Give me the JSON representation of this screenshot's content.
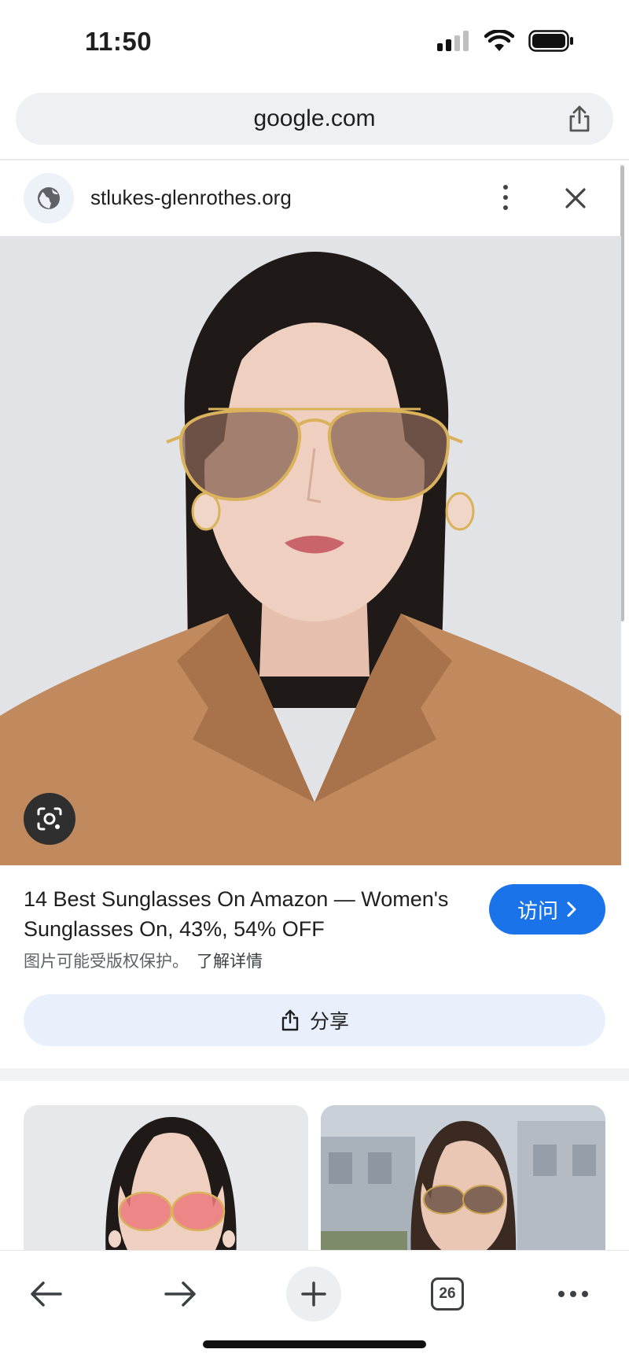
{
  "status_bar": {
    "time": "11:50",
    "icons": [
      "cellular-signal-icon",
      "wifi-icon",
      "battery-icon"
    ]
  },
  "address_bar": {
    "url": "google.com",
    "share_icon": "share-icon"
  },
  "site_header": {
    "site_name": "stlukes-glenrothes.org",
    "icons": [
      "globe-icon",
      "more-vert-icon",
      "close-icon"
    ]
  },
  "main_image": {
    "lens_icon": "google-lens-icon"
  },
  "result": {
    "title": "14 Best Sunglasses On Amazon — Women's Sunglasses On, 43%, 54% OFF",
    "copyright_notice": "图片可能受版权保护。",
    "learn_more": "了解详情",
    "visit_label": "访问",
    "share_label": "分享"
  },
  "toolbar": {
    "tab_count": "26",
    "icons": [
      "back-arrow-icon",
      "forward-arrow-icon",
      "new-tab-plus-icon",
      "tab-switcher-icon",
      "more-horiz-icon"
    ]
  },
  "colors": {
    "accent": "#1a73e8",
    "share_button_bg": "#e9f0fc",
    "address_bar_bg": "#eef0f3",
    "blazer": "#c08a5e"
  }
}
